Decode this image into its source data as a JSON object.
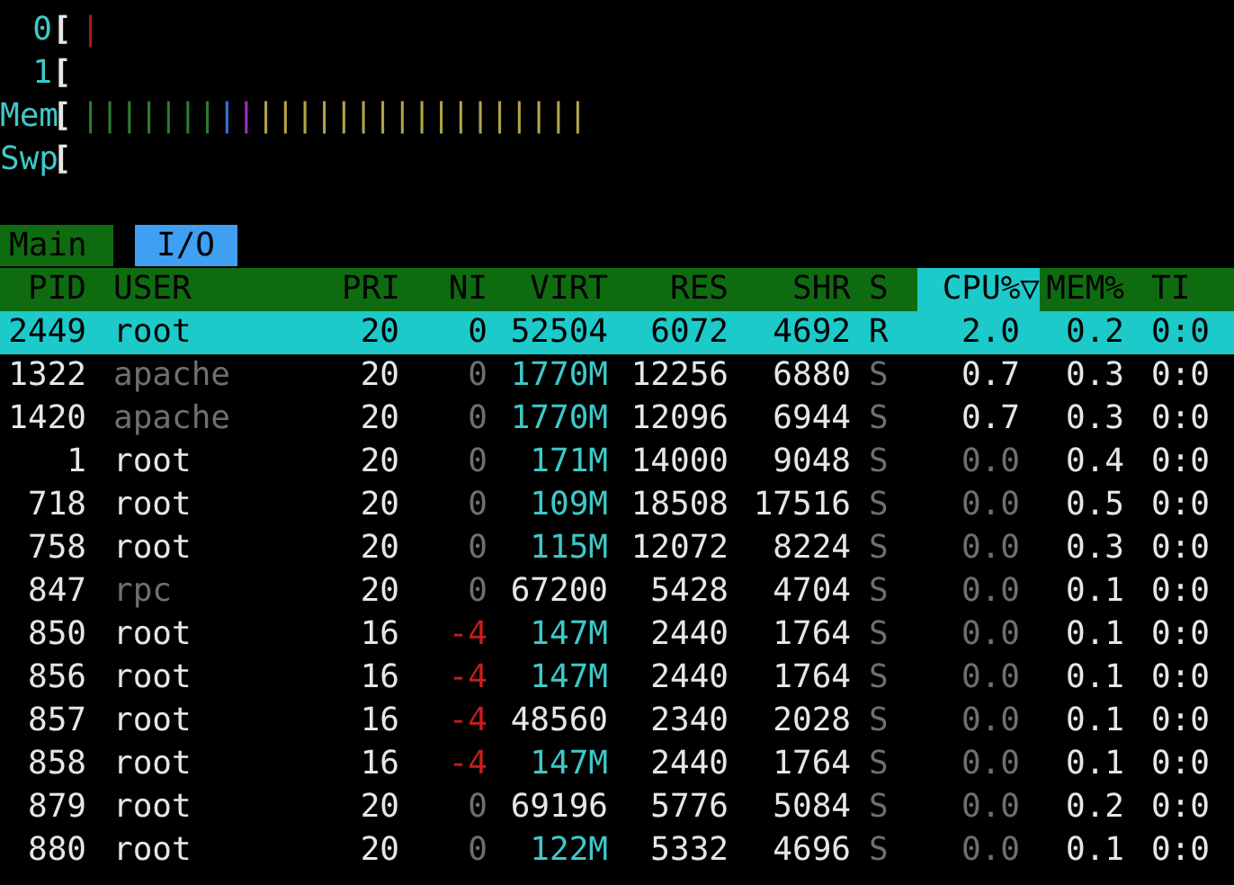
{
  "meters": [
    {
      "label": "0",
      "bracket": "[",
      "bars": [
        {
          "kind": "cpu",
          "text": "|"
        }
      ]
    },
    {
      "label": "1",
      "bracket": "["
    },
    {
      "label": "Mem",
      "bracket": "[",
      "bars": [
        {
          "kind": "used",
          "text": "|||||||"
        },
        {
          "kind": "buffers",
          "text": "|"
        },
        {
          "kind": "shared",
          "text": "|"
        },
        {
          "kind": "cache",
          "text": "|||||||||||||||||"
        }
      ]
    },
    {
      "label": "Swp",
      "bracket": "["
    }
  ],
  "tabs": [
    {
      "label": "Main",
      "selected": true
    },
    {
      "label": "I/O",
      "selected": false
    }
  ],
  "columns": [
    {
      "label": "PID",
      "sorted": false
    },
    {
      "label": "USER",
      "sorted": false
    },
    {
      "label": "PRI",
      "sorted": false
    },
    {
      "label": "NI",
      "sorted": false
    },
    {
      "label": "VIRT",
      "sorted": false
    },
    {
      "label": "RES",
      "sorted": false
    },
    {
      "label": "SHR",
      "sorted": false
    },
    {
      "label": "S",
      "sorted": false
    },
    {
      "label": "CPU%▽",
      "sorted": true
    },
    {
      "label": "MEM%",
      "sorted": false
    },
    {
      "label": "TI",
      "sorted": false
    }
  ],
  "rows": [
    {
      "selected": true,
      "pid": "2449",
      "user": "root",
      "pri": "20",
      "ni": "0",
      "virt": "52504",
      "res": "6072",
      "shr": "4692",
      "state": "R",
      "cpu": "2.0",
      "mem": "0.2",
      "time": "0:0"
    },
    {
      "selected": false,
      "pid": "1322",
      "user": "apache",
      "user_dimmed": true,
      "pri": "20",
      "ni": "0",
      "ni_negative": false,
      "virt": "1770M",
      "res": "12256",
      "shr": "6880",
      "state": "S",
      "cpu": "0.7",
      "cpu_idle": false,
      "mem": "0.3",
      "time": "0:0"
    },
    {
      "selected": false,
      "pid": "1420",
      "user": "apache",
      "user_dimmed": true,
      "pri": "20",
      "ni": "0",
      "ni_negative": false,
      "virt": "1770M",
      "res": "12096",
      "shr": "6944",
      "state": "S",
      "cpu": "0.7",
      "cpu_idle": false,
      "mem": "0.3",
      "time": "0:0"
    },
    {
      "selected": false,
      "pid": "1",
      "user": "root",
      "user_dimmed": false,
      "pri": "20",
      "ni": "0",
      "ni_negative": false,
      "virt": "171M",
      "res": "14000",
      "shr": "9048",
      "state": "S",
      "cpu": "0.0",
      "cpu_idle": true,
      "mem": "0.4",
      "time": "0:0"
    },
    {
      "selected": false,
      "pid": "718",
      "user": "root",
      "user_dimmed": false,
      "pri": "20",
      "ni": "0",
      "ni_negative": false,
      "virt": "109M",
      "res": "18508",
      "shr": "17516",
      "state": "S",
      "cpu": "0.0",
      "cpu_idle": true,
      "mem": "0.5",
      "time": "0:0"
    },
    {
      "selected": false,
      "pid": "758",
      "user": "root",
      "user_dimmed": false,
      "pri": "20",
      "ni": "0",
      "ni_negative": false,
      "virt": "115M",
      "res": "12072",
      "shr": "8224",
      "state": "S",
      "cpu": "0.0",
      "cpu_idle": true,
      "mem": "0.3",
      "time": "0:0"
    },
    {
      "selected": false,
      "pid": "847",
      "user": "rpc",
      "user_dimmed": true,
      "pri": "20",
      "ni": "0",
      "ni_negative": false,
      "virt": "67200",
      "res": "5428",
      "shr": "4704",
      "state": "S",
      "cpu": "0.0",
      "cpu_idle": true,
      "mem": "0.1",
      "time": "0:0"
    },
    {
      "selected": false,
      "pid": "850",
      "user": "root",
      "user_dimmed": false,
      "pri": "16",
      "ni": "-4",
      "ni_negative": true,
      "virt": "147M",
      "res": "2440",
      "shr": "1764",
      "state": "S",
      "cpu": "0.0",
      "cpu_idle": true,
      "mem": "0.1",
      "time": "0:0"
    },
    {
      "selected": false,
      "pid": "856",
      "user": "root",
      "user_dimmed": false,
      "pri": "16",
      "ni": "-4",
      "ni_negative": true,
      "virt": "147M",
      "res": "2440",
      "shr": "1764",
      "state": "S",
      "cpu": "0.0",
      "cpu_idle": true,
      "mem": "0.1",
      "time": "0:0"
    },
    {
      "selected": false,
      "pid": "857",
      "user": "root",
      "user_dimmed": false,
      "pri": "16",
      "ni": "-4",
      "ni_negative": true,
      "virt": "48560",
      "res": "2340",
      "shr": "2028",
      "state": "S",
      "cpu": "0.0",
      "cpu_idle": true,
      "mem": "0.1",
      "time": "0:0"
    },
    {
      "selected": false,
      "pid": "858",
      "user": "root",
      "user_dimmed": false,
      "pri": "16",
      "ni": "-4",
      "ni_negative": true,
      "virt": "147M",
      "res": "2440",
      "shr": "1764",
      "state": "S",
      "cpu": "0.0",
      "cpu_idle": true,
      "mem": "0.1",
      "time": "0:0"
    },
    {
      "selected": false,
      "pid": "879",
      "user": "root",
      "user_dimmed": false,
      "pri": "20",
      "ni": "0",
      "ni_negative": false,
      "virt": "69196",
      "res": "5776",
      "shr": "5084",
      "state": "S",
      "cpu": "0.0",
      "cpu_idle": true,
      "mem": "0.2",
      "time": "0:0"
    },
    {
      "selected": false,
      "pid": "880",
      "user": "root",
      "user_dimmed": false,
      "pri": "20",
      "ni": "0",
      "ni_negative": false,
      "virt": "122M",
      "res": "5332",
      "shr": "4696",
      "state": "S",
      "cpu": "0.0",
      "cpu_idle": true,
      "mem": "0.1",
      "time": "0:0"
    }
  ]
}
